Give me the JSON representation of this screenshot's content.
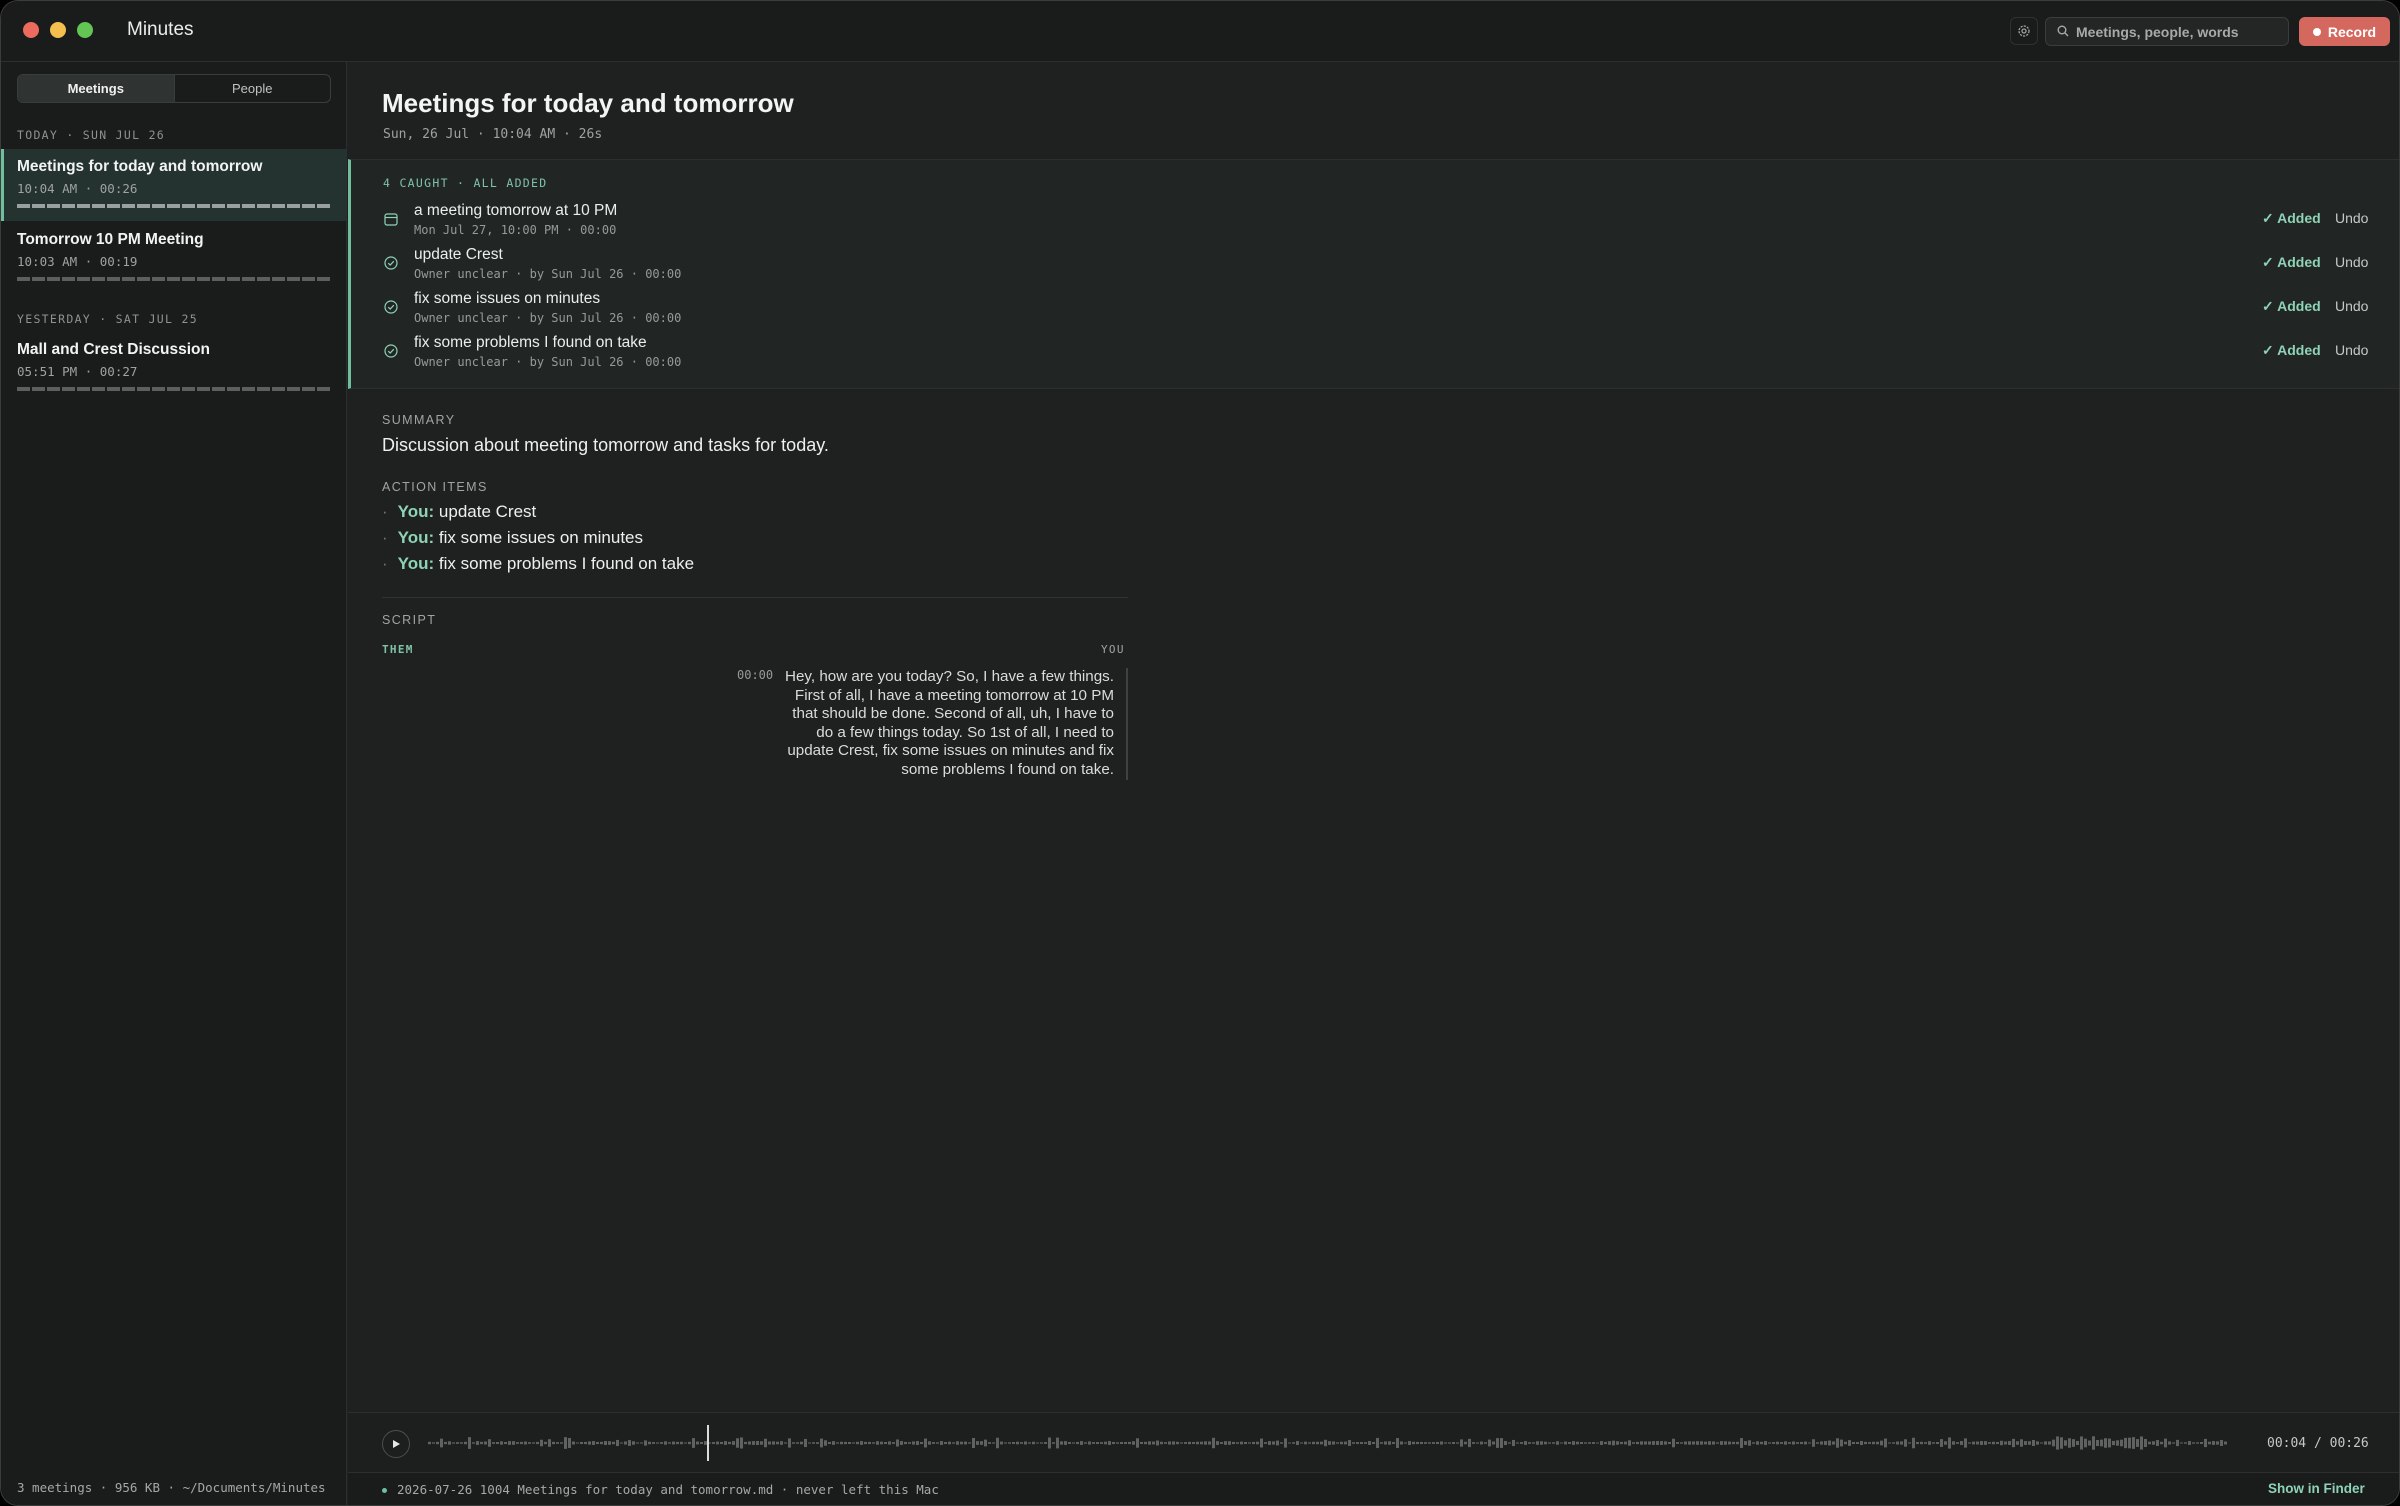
{
  "app": {
    "title": "Minutes"
  },
  "toolbar": {
    "search_placeholder": "Meetings, people, words",
    "record_label": "Record"
  },
  "sidebar": {
    "tabs": [
      {
        "label": "Meetings",
        "active": true
      },
      {
        "label": "People",
        "active": false
      }
    ],
    "groups": [
      {
        "label": "TODAY · SUN JUL 26",
        "items": [
          {
            "title": "Meetings for today and tomorrow",
            "meta": "10:04 AM · 00:26",
            "selected": true
          },
          {
            "title": "Tomorrow 10 PM Meeting",
            "meta": "10:03 AM · 00:19",
            "selected": false
          }
        ]
      },
      {
        "label": "YESTERDAY · SAT JUL 25",
        "items": [
          {
            "title": "Mall and Crest Discussion",
            "meta": "05:51 PM · 00:27",
            "selected": false
          }
        ]
      }
    ],
    "footer": "3 meetings · 956 KB · ~/Documents/Minutes"
  },
  "meeting": {
    "title": "Meetings for today and tomorrow",
    "subtitle": "Sun, 26 Jul · 10:04 AM · 26s",
    "caught": {
      "header": "4 CAUGHT · ALL ADDED",
      "items": [
        {
          "icon": "calendar-icon",
          "title": "a meeting tomorrow at 10 PM",
          "meta": "Mon Jul 27, 10:00 PM · 00:00",
          "status": "✓ Added",
          "undo": "Undo"
        },
        {
          "icon": "check-circle-icon",
          "title": "update Crest",
          "meta": "Owner unclear · by Sun Jul 26 · 00:00",
          "status": "✓ Added",
          "undo": "Undo"
        },
        {
          "icon": "check-circle-icon",
          "title": "fix some issues on minutes",
          "meta": "Owner unclear · by Sun Jul 26 · 00:00",
          "status": "✓ Added",
          "undo": "Undo"
        },
        {
          "icon": "check-circle-icon",
          "title": "fix some problems I found on take",
          "meta": "Owner unclear · by Sun Jul 26 · 00:00",
          "status": "✓ Added",
          "undo": "Undo"
        }
      ]
    },
    "summary_label": "SUMMARY",
    "summary": "Discussion about meeting tomorrow and tasks for today.",
    "action_items_label": "ACTION ITEMS",
    "action_items": [
      {
        "who": "You:",
        "text": " update Crest"
      },
      {
        "who": "You:",
        "text": " fix some issues on minutes"
      },
      {
        "who": "You:",
        "text": " fix some problems I found on take"
      }
    ],
    "script_label": "SCRIPT",
    "script": {
      "them_label": "THEM",
      "you_label": "YOU",
      "turns": [
        {
          "time": "00:00",
          "text": "Hey, how are you today? So, I have a few things. First of all, I have a meeting tomorrow at 10 PM that should be done. Second of all, uh, I have to do a few things today. So 1st of all, I need to update Crest, fix some issues on minutes and fix some problems I found on take."
        }
      ]
    }
  },
  "player": {
    "time": "00:04 / 00:26",
    "progress": 0.154
  },
  "status": {
    "file": "2026-07-26 1004 Meetings for today and tomorrow.md · never left this Mac",
    "finder_label": "Show in Finder"
  },
  "colors": {
    "accent": "#6fbf9f",
    "record": "#d5685e",
    "background": "#1f2121"
  }
}
